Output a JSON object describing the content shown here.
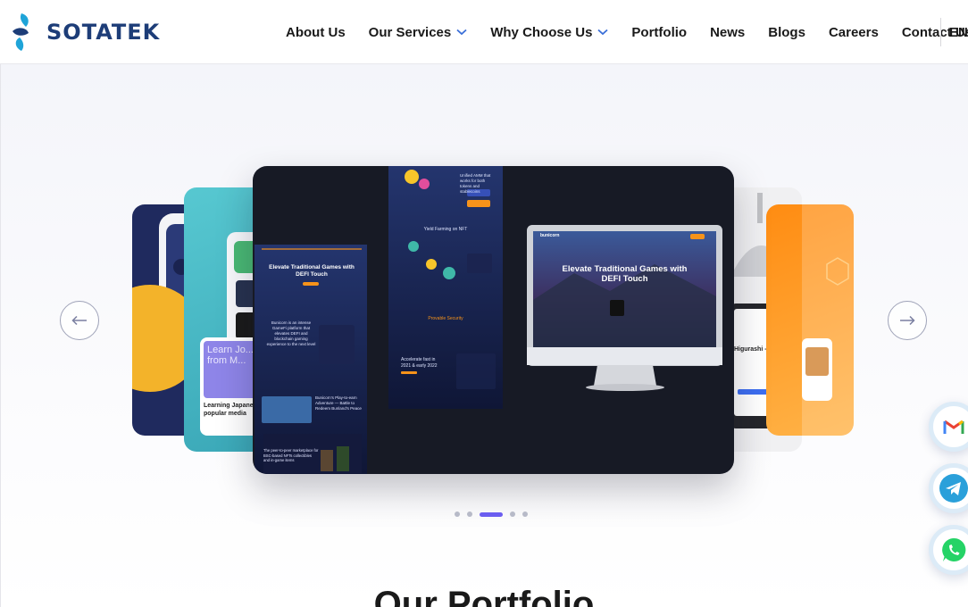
{
  "brand": {
    "name": "SOTATEK"
  },
  "nav": {
    "items": [
      {
        "label": "About Us",
        "has_dropdown": false
      },
      {
        "label": "Our Services",
        "has_dropdown": true
      },
      {
        "label": "Why Choose Us",
        "has_dropdown": true
      },
      {
        "label": "Portfolio",
        "has_dropdown": false
      },
      {
        "label": "News",
        "has_dropdown": false
      },
      {
        "label": "Blogs",
        "has_dropdown": false
      },
      {
        "label": "Careers",
        "has_dropdown": false
      },
      {
        "label": "Contact Us",
        "has_dropdown": false
      }
    ],
    "language": "EN"
  },
  "carousel": {
    "main_slide": {
      "left_panel_heading": "Elevate Traditional Games with DEFI Touch",
      "left_panel_body": "Bunicorn is an intense GameFi platform that elevates DEFI and blockchain gaming experience to the next level",
      "left_panel_feature": "Bunicorn's Play-to-earn Adventure — Battle to Redeem Bunland's Peace",
      "left_panel_footer": "The peer-to-peer marketplace for BSC-based NFTs collectibles and in-game items",
      "middle_panel_top": "Unified AMM that works for both tokens and stablecoins",
      "middle_panel_section1": "Yield Farming on NFT",
      "middle_panel_section2": "Provable Security",
      "middle_panel_section3": "Accelerate fast in 2021 & early 2022",
      "monitor_brand": "bunicorn",
      "monitor_heading": "Elevate Traditional Games with DEFI Touch"
    },
    "left_card_text": {
      "overlay": "Learn Jo... from M...",
      "caption": "Learning Japanese popular media"
    },
    "right_card_text": {
      "name": "Higurashi -"
    },
    "dots": {
      "count": 5,
      "active_index": 2
    }
  },
  "section": {
    "title": "Our Portfolio"
  },
  "contact_float": [
    "gmail-icon",
    "telegram-icon",
    "whatsapp-icon"
  ],
  "colors": {
    "brand_blue": "#1d3d78",
    "brand_cyan": "#1fa4d8",
    "accent_purple": "#6b5df0",
    "accent_orange": "#f7931a"
  }
}
